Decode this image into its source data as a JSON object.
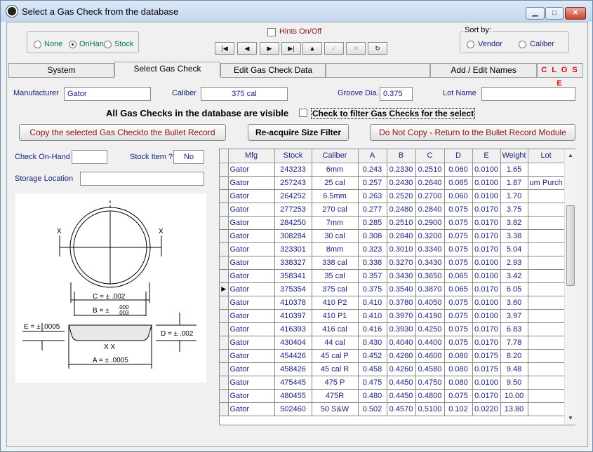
{
  "window": {
    "title": "Select a Gas Check from the database",
    "min_icon": "minimize-icon",
    "max_icon": "maximize-icon",
    "close_icon": "close-icon"
  },
  "filter_group": {
    "options": [
      "None",
      "OnHand",
      "Stock"
    ],
    "selected": "OnHand"
  },
  "hints": {
    "label": "Hints On/Off",
    "checked": false
  },
  "nav_buttons": [
    "|◀",
    "◀",
    "▶",
    "▶|",
    "▲",
    "✓",
    "✕",
    "↻"
  ],
  "sort_by": {
    "title": "Sort by:",
    "options": [
      "Vendor",
      "Caliber"
    ],
    "selected": null
  },
  "tabs": {
    "system": "System",
    "select": "Select Gas Check",
    "edit": "Edit Gas Check Data",
    "blank": "",
    "names": "Add / Edit Names",
    "close": "C L O S E"
  },
  "fields": {
    "manufacturer_label": "Manufacturer",
    "manufacturer_value": "Gator",
    "caliber_label": "Caliber",
    "caliber_value": "375 cal",
    "groove_label": "Groove Dia.",
    "groove_value": "0.375",
    "lot_label": "Lot Name",
    "lot_value": ""
  },
  "visible_msg": "All Gas Checks in the database are visible",
  "filter_checkbox_label": "Check to filter Gas Checks for the select",
  "buttons": {
    "copy": "Copy the selected Gas Checkto the Bullet Record",
    "reacquire": "Re-acquire Size Filter",
    "nocopy": "Do Not Copy - Return to the Bullet Record Module"
  },
  "left_panel": {
    "onhand_label": "Check On-Hand",
    "onhand_value": "",
    "stock_item_label": "Stock Item ?",
    "stock_item_value": "No",
    "storage_label": "Storage Location",
    "storage_value": ""
  },
  "diagram_labels": {
    "x_left": "X",
    "x_right": "X",
    "c": "C = ± .002",
    "b_main": "B = ±",
    "b_top": ".000",
    "b_bot": ".003",
    "e": "E = ± .0005",
    "d": "D = ± .002",
    "xx": "X X",
    "a": "A = ± .0005"
  },
  "table": {
    "columns": [
      "Mfg",
      "Stock",
      "Caliber",
      "A",
      "B",
      "C",
      "D",
      "E",
      "Weight",
      "Lot"
    ],
    "selected_row": 9,
    "rows": [
      [
        "Gator",
        "243233",
        "6mm",
        "0.243",
        "0.2330",
        "0.2510",
        "0.060",
        "0.0100",
        "1.65",
        ""
      ],
      [
        "Gator",
        "257243",
        "25 cal",
        "0.257",
        "0.2430",
        "0.2640",
        "0.065",
        "0.0100",
        "1.87",
        "um Purch"
      ],
      [
        "Gator",
        "264252",
        "6.5mm",
        "0.263",
        "0.2520",
        "0.2700",
        "0.060",
        "0.0100",
        "1.70",
        ""
      ],
      [
        "Gator",
        "277253",
        "270 cal",
        "0.277",
        "0.2480",
        "0.2840",
        "0.075",
        "0.0170",
        "3.75",
        ""
      ],
      [
        "Gator",
        "284250",
        "7mm",
        "0.285",
        "0.2510",
        "0.2900",
        "0.075",
        "0.0170",
        "3.82",
        ""
      ],
      [
        "Gator",
        "308284",
        "30 cal",
        "0.308",
        "0.2840",
        "0.3200",
        "0.075",
        "0.0170",
        "3.38",
        ""
      ],
      [
        "Gator",
        "323301",
        "8mm",
        "0.323",
        "0.3010",
        "0.3340",
        "0.075",
        "0.0170",
        "5.04",
        ""
      ],
      [
        "Gator",
        "338327",
        "338 cal",
        "0.338",
        "0.3270",
        "0.3430",
        "0.075",
        "0.0100",
        "2.93",
        ""
      ],
      [
        "Gator",
        "358341",
        "35 cal",
        "0.357",
        "0.3430",
        "0.3650",
        "0.065",
        "0.0100",
        "3.42",
        ""
      ],
      [
        "Gator",
        "375354",
        "375 cal",
        "0.375",
        "0.3540",
        "0.3870",
        "0.065",
        "0.0170",
        "6.05",
        ""
      ],
      [
        "Gator",
        "410378",
        "410 P2",
        "0.410",
        "0.3780",
        "0.4050",
        "0.075",
        "0.0100",
        "3.60",
        ""
      ],
      [
        "Gator",
        "410397",
        "410 P1",
        "0.410",
        "0.3970",
        "0.4190",
        "0.075",
        "0.0100",
        "3.97",
        ""
      ],
      [
        "Gator",
        "416393",
        "416 cal",
        "0.416",
        "0.3930",
        "0.4250",
        "0.075",
        "0.0170",
        "6.83",
        ""
      ],
      [
        "Gator",
        "430404",
        "44 cal",
        "0.430",
        "0.4040",
        "0.4400",
        "0.075",
        "0.0170",
        "7.78",
        ""
      ],
      [
        "Gator",
        "454426",
        "45 cal P",
        "0.452",
        "0.4260",
        "0.4600",
        "0.080",
        "0.0175",
        "8.20",
        ""
      ],
      [
        "Gator",
        "458426",
        "45 cal R",
        "0.458",
        "0.4260",
        "0.4580",
        "0.080",
        "0.0175",
        "9.48",
        ""
      ],
      [
        "Gator",
        "475445",
        "475 P",
        "0.475",
        "0.4450",
        "0.4750",
        "0.080",
        "0.0100",
        "9.50",
        ""
      ],
      [
        "Gator",
        "480455",
        "475R",
        "0.480",
        "0.4450",
        "0.4800",
        "0.075",
        "0.0170",
        "10.00",
        ""
      ],
      [
        "Gator",
        "502460",
        "50 S&W",
        "0.502",
        "0.4570",
        "0.5100",
        "0.102",
        "0.0220",
        "13.80",
        ""
      ]
    ]
  }
}
